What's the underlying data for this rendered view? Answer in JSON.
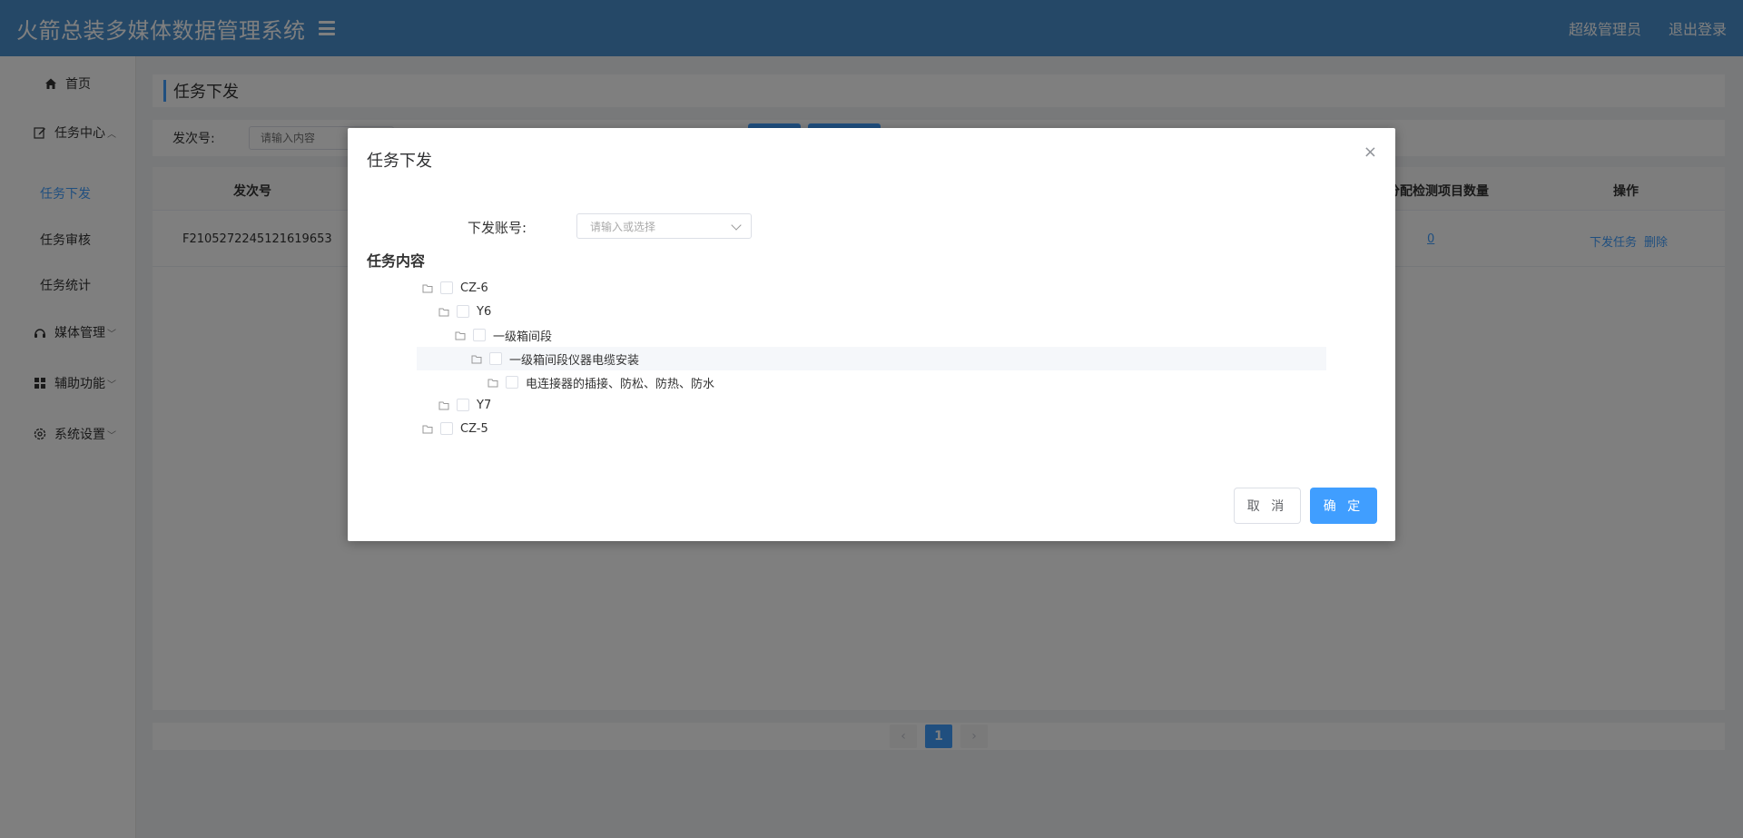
{
  "header": {
    "title": "火箭总装多媒体数据管理系统",
    "user_label": "超级管理员",
    "logout_label": "退出登录"
  },
  "sidebar": {
    "home": "首页",
    "task_center": "任务中心",
    "task_sub": [
      "任务下发",
      "任务审核",
      "任务统计"
    ],
    "media_mgmt": "媒体管理",
    "aux_func": "辅助功能",
    "sys_settings": "系统设置"
  },
  "main": {
    "breadcrumb": "任务下发",
    "search": {
      "label": "发次号:",
      "placeholder": "请输入内容"
    },
    "table": {
      "col_batch": "发次号",
      "col_count": "分配检测项目数量",
      "col_ops": "操作",
      "row": {
        "batch": "F2105272245121619653",
        "count": "0",
        "op_dispatch": "下发任务",
        "op_delete": "删除"
      }
    },
    "pager": {
      "prev": "‹",
      "current": "1",
      "next": "›"
    }
  },
  "dialog": {
    "title": "任务下发",
    "close": "×",
    "account_label": "下发账号:",
    "account_placeholder": "请输入或选择",
    "content_label": "任务内容",
    "tree": [
      {
        "label": "CZ-6"
      },
      {
        "label": "Y6"
      },
      {
        "label": "一级箱间段"
      },
      {
        "label": "一级箱间段仪器电缆安装"
      },
      {
        "label": "电连接器的插接、防松、防热、防水"
      },
      {
        "label": "Y7"
      },
      {
        "label": "CZ-5"
      }
    ],
    "cancel": "取 消",
    "ok": "确 定"
  }
}
